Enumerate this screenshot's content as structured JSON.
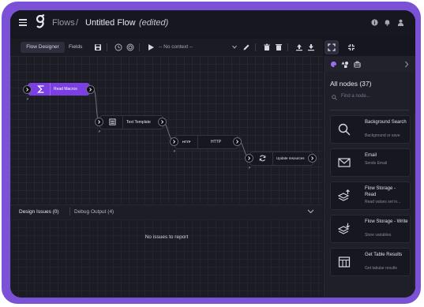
{
  "header": {
    "flows_label": "Flows",
    "separator": "/",
    "flow_title": "Untitled Flow",
    "edited_label": "(edited)",
    "icons": [
      "info-icon",
      "bell-icon",
      "user-icon"
    ]
  },
  "toolbar": {
    "tab_designer": "Flow Designer",
    "tab_fields": "Fields",
    "context_select_value": "-- No context --",
    "icons": [
      "save-icon",
      "history-icon",
      "target-icon",
      "play-icon",
      "edit-icon",
      "delete-icon",
      "copy-icon",
      "upload-icon",
      "download-icon",
      "expand-icon",
      "collapse-icon"
    ]
  },
  "nodes": [
    {
      "label": "Read Macros",
      "sub": "P",
      "icon": "sigma-icon",
      "accent": "#7b3fe4"
    },
    {
      "label": "Text Template",
      "sub": "P",
      "icon": "template-icon"
    },
    {
      "label": "HTTP",
      "badge": "HTTP",
      "sub": "P"
    },
    {
      "label": "Update resources",
      "sub": "P",
      "icon": "refresh-icon"
    }
  ],
  "bottom_panel": {
    "tab_issues": "Design Issues (0)",
    "tab_debug": "Debug Output (4)",
    "empty_message": "No issues to report"
  },
  "right_panel": {
    "title": "All nodes (37)",
    "search_placeholder": "Find a node...",
    "tab_icons": [
      "palette-icon",
      "shapes-icon",
      "briefcase-icon"
    ],
    "nodes": [
      {
        "name": "Background Search",
        "desc": "Background or save",
        "icon": "search-icon"
      },
      {
        "name": "Email",
        "desc": "Sends Email",
        "icon": "email-icon"
      },
      {
        "name": "Flow Storage - Read",
        "desc": "Read values set in...",
        "icon": "storage-read-icon"
      },
      {
        "name": "Flow Storage - Write",
        "desc": "Store variables",
        "icon": "storage-write-icon"
      },
      {
        "name": "Get Table Results",
        "desc": "Get tabular results",
        "icon": "table-icon"
      }
    ]
  },
  "colors": {
    "accent": "#7b52d6",
    "node_highlight": "#7b3fe4",
    "background": "#16161e"
  }
}
